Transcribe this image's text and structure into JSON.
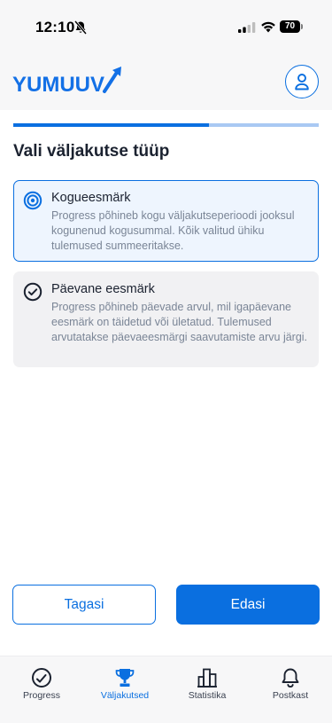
{
  "status_bar": {
    "time": "12:10",
    "battery": "70",
    "icons": [
      "bell-off-icon",
      "signal-icon",
      "wifi-icon",
      "battery-icon"
    ]
  },
  "header": {
    "logo_text": "YUMUUV",
    "profile_icon": "user-icon"
  },
  "wizard": {
    "progress": 0.64,
    "title": "Vali väljakutse tüüp",
    "options": [
      {
        "title": "Kogueesmärk",
        "description": "Progress põhineb kogu väljakutseperioodi jooksul kogunenud kogusummal. Kõik valitud ühiku tulemused summeeritakse.",
        "icon": "target-icon",
        "selected": true
      },
      {
        "title": "Päevane eesmärk",
        "description": "Progress põhineb päevade arvul, mil igapäevane eesmärk on täidetud või ületatud. Tulemused arvutatakse päevaeesmärgi saavutamiste arvu järgi.",
        "icon": "check-circle-icon",
        "selected": false
      }
    ],
    "back_label": "Tagasi",
    "next_label": "Edasi"
  },
  "nav": {
    "items": [
      {
        "label": "Progress",
        "icon": "progress-gauge-icon",
        "active": false
      },
      {
        "label": "Väljakutsed",
        "icon": "trophy-icon",
        "active": true
      },
      {
        "label": "Statistika",
        "icon": "bar-chart-icon",
        "active": false
      },
      {
        "label": "Postkast",
        "icon": "bell-icon",
        "active": false
      }
    ]
  },
  "colors": {
    "accent": "#0a6fe0",
    "accent_light": "#a9c9f3",
    "selected_bg": "#eef5fe",
    "card_bg": "#f1f1f3",
    "muted_text": "#7a8596",
    "logo_blue": "#1370e6"
  }
}
